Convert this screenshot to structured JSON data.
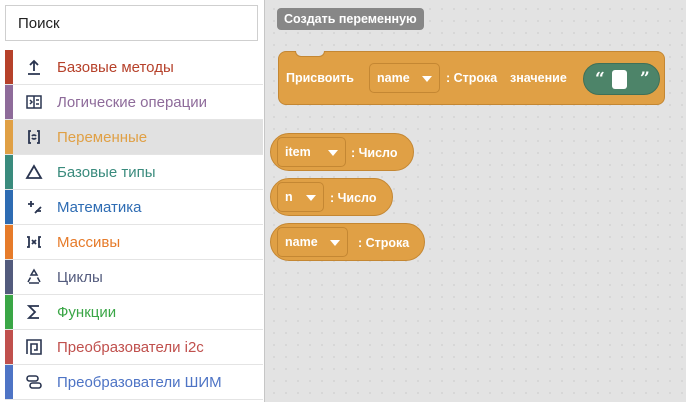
{
  "search": {
    "placeholder": "Поиск",
    "value": ""
  },
  "categories": [
    {
      "label": "Базовые методы",
      "color": "#b6412a",
      "icon": "upload-arrow-icon"
    },
    {
      "label": "Логические операции",
      "color": "#8e6b9a",
      "icon": "logic-split-icon"
    },
    {
      "label": "Переменные",
      "color": "#e0a045",
      "icon": "refresh-brackets-icon",
      "selected": true
    },
    {
      "label": "Базовые типы",
      "color": "#3a8b7d",
      "icon": "triangle-icon"
    },
    {
      "label": "Математика",
      "color": "#2e6cb3",
      "icon": "plus-minus-icon"
    },
    {
      "label": "Массивы",
      "color": "#e67b2a",
      "icon": "array-brackets-icon"
    },
    {
      "label": "Циклы",
      "color": "#535b7d",
      "icon": "recycle-icon"
    },
    {
      "label": "Функции",
      "color": "#3aa646",
      "icon": "sigma-icon"
    },
    {
      "label": "Преобразователи i2c",
      "color": "#c0504d",
      "icon": "spiral-square-icon"
    },
    {
      "label": "Преобразователи ШИМ",
      "color": "#4e74c5",
      "icon": "pwm-icon"
    }
  ],
  "workspace": {
    "create_button": "Создать переменную",
    "assign_block": {
      "label": "Присвоить",
      "var": "name",
      "type": ": Строка",
      "value_label": "значение",
      "quote_open": "“",
      "quote_close": "”"
    },
    "variables": [
      {
        "name": "item",
        "type": ": Число"
      },
      {
        "name": "n",
        "type": ": Число"
      },
      {
        "name": "name",
        "type": ": Строка"
      }
    ]
  }
}
